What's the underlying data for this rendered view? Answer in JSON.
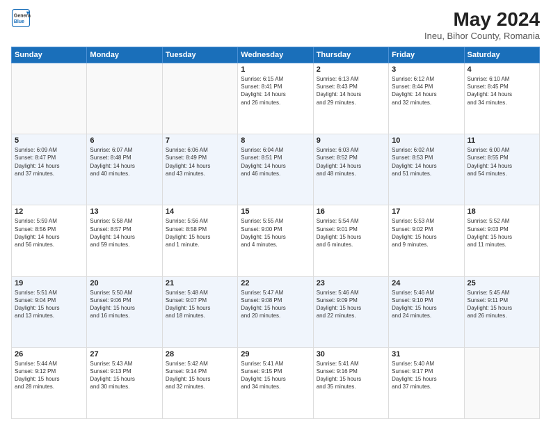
{
  "header": {
    "logo_line1": "General",
    "logo_line2": "Blue",
    "title": "May 2024",
    "subtitle": "Ineu, Bihor County, Romania"
  },
  "calendar": {
    "headers": [
      "Sunday",
      "Monday",
      "Tuesday",
      "Wednesday",
      "Thursday",
      "Friday",
      "Saturday"
    ],
    "weeks": [
      [
        {
          "day": "",
          "info": ""
        },
        {
          "day": "",
          "info": ""
        },
        {
          "day": "",
          "info": ""
        },
        {
          "day": "1",
          "info": "Sunrise: 6:15 AM\nSunset: 8:41 PM\nDaylight: 14 hours\nand 26 minutes."
        },
        {
          "day": "2",
          "info": "Sunrise: 6:13 AM\nSunset: 8:43 PM\nDaylight: 14 hours\nand 29 minutes."
        },
        {
          "day": "3",
          "info": "Sunrise: 6:12 AM\nSunset: 8:44 PM\nDaylight: 14 hours\nand 32 minutes."
        },
        {
          "day": "4",
          "info": "Sunrise: 6:10 AM\nSunset: 8:45 PM\nDaylight: 14 hours\nand 34 minutes."
        }
      ],
      [
        {
          "day": "5",
          "info": "Sunrise: 6:09 AM\nSunset: 8:47 PM\nDaylight: 14 hours\nand 37 minutes."
        },
        {
          "day": "6",
          "info": "Sunrise: 6:07 AM\nSunset: 8:48 PM\nDaylight: 14 hours\nand 40 minutes."
        },
        {
          "day": "7",
          "info": "Sunrise: 6:06 AM\nSunset: 8:49 PM\nDaylight: 14 hours\nand 43 minutes."
        },
        {
          "day": "8",
          "info": "Sunrise: 6:04 AM\nSunset: 8:51 PM\nDaylight: 14 hours\nand 46 minutes."
        },
        {
          "day": "9",
          "info": "Sunrise: 6:03 AM\nSunset: 8:52 PM\nDaylight: 14 hours\nand 48 minutes."
        },
        {
          "day": "10",
          "info": "Sunrise: 6:02 AM\nSunset: 8:53 PM\nDaylight: 14 hours\nand 51 minutes."
        },
        {
          "day": "11",
          "info": "Sunrise: 6:00 AM\nSunset: 8:55 PM\nDaylight: 14 hours\nand 54 minutes."
        }
      ],
      [
        {
          "day": "12",
          "info": "Sunrise: 5:59 AM\nSunset: 8:56 PM\nDaylight: 14 hours\nand 56 minutes."
        },
        {
          "day": "13",
          "info": "Sunrise: 5:58 AM\nSunset: 8:57 PM\nDaylight: 14 hours\nand 59 minutes."
        },
        {
          "day": "14",
          "info": "Sunrise: 5:56 AM\nSunset: 8:58 PM\nDaylight: 15 hours\nand 1 minute."
        },
        {
          "day": "15",
          "info": "Sunrise: 5:55 AM\nSunset: 9:00 PM\nDaylight: 15 hours\nand 4 minutes."
        },
        {
          "day": "16",
          "info": "Sunrise: 5:54 AM\nSunset: 9:01 PM\nDaylight: 15 hours\nand 6 minutes."
        },
        {
          "day": "17",
          "info": "Sunrise: 5:53 AM\nSunset: 9:02 PM\nDaylight: 15 hours\nand 9 minutes."
        },
        {
          "day": "18",
          "info": "Sunrise: 5:52 AM\nSunset: 9:03 PM\nDaylight: 15 hours\nand 11 minutes."
        }
      ],
      [
        {
          "day": "19",
          "info": "Sunrise: 5:51 AM\nSunset: 9:04 PM\nDaylight: 15 hours\nand 13 minutes."
        },
        {
          "day": "20",
          "info": "Sunrise: 5:50 AM\nSunset: 9:06 PM\nDaylight: 15 hours\nand 16 minutes."
        },
        {
          "day": "21",
          "info": "Sunrise: 5:48 AM\nSunset: 9:07 PM\nDaylight: 15 hours\nand 18 minutes."
        },
        {
          "day": "22",
          "info": "Sunrise: 5:47 AM\nSunset: 9:08 PM\nDaylight: 15 hours\nand 20 minutes."
        },
        {
          "day": "23",
          "info": "Sunrise: 5:46 AM\nSunset: 9:09 PM\nDaylight: 15 hours\nand 22 minutes."
        },
        {
          "day": "24",
          "info": "Sunrise: 5:46 AM\nSunset: 9:10 PM\nDaylight: 15 hours\nand 24 minutes."
        },
        {
          "day": "25",
          "info": "Sunrise: 5:45 AM\nSunset: 9:11 PM\nDaylight: 15 hours\nand 26 minutes."
        }
      ],
      [
        {
          "day": "26",
          "info": "Sunrise: 5:44 AM\nSunset: 9:12 PM\nDaylight: 15 hours\nand 28 minutes."
        },
        {
          "day": "27",
          "info": "Sunrise: 5:43 AM\nSunset: 9:13 PM\nDaylight: 15 hours\nand 30 minutes."
        },
        {
          "day": "28",
          "info": "Sunrise: 5:42 AM\nSunset: 9:14 PM\nDaylight: 15 hours\nand 32 minutes."
        },
        {
          "day": "29",
          "info": "Sunrise: 5:41 AM\nSunset: 9:15 PM\nDaylight: 15 hours\nand 34 minutes."
        },
        {
          "day": "30",
          "info": "Sunrise: 5:41 AM\nSunset: 9:16 PM\nDaylight: 15 hours\nand 35 minutes."
        },
        {
          "day": "31",
          "info": "Sunrise: 5:40 AM\nSunset: 9:17 PM\nDaylight: 15 hours\nand 37 minutes."
        },
        {
          "day": "",
          "info": ""
        }
      ]
    ]
  }
}
